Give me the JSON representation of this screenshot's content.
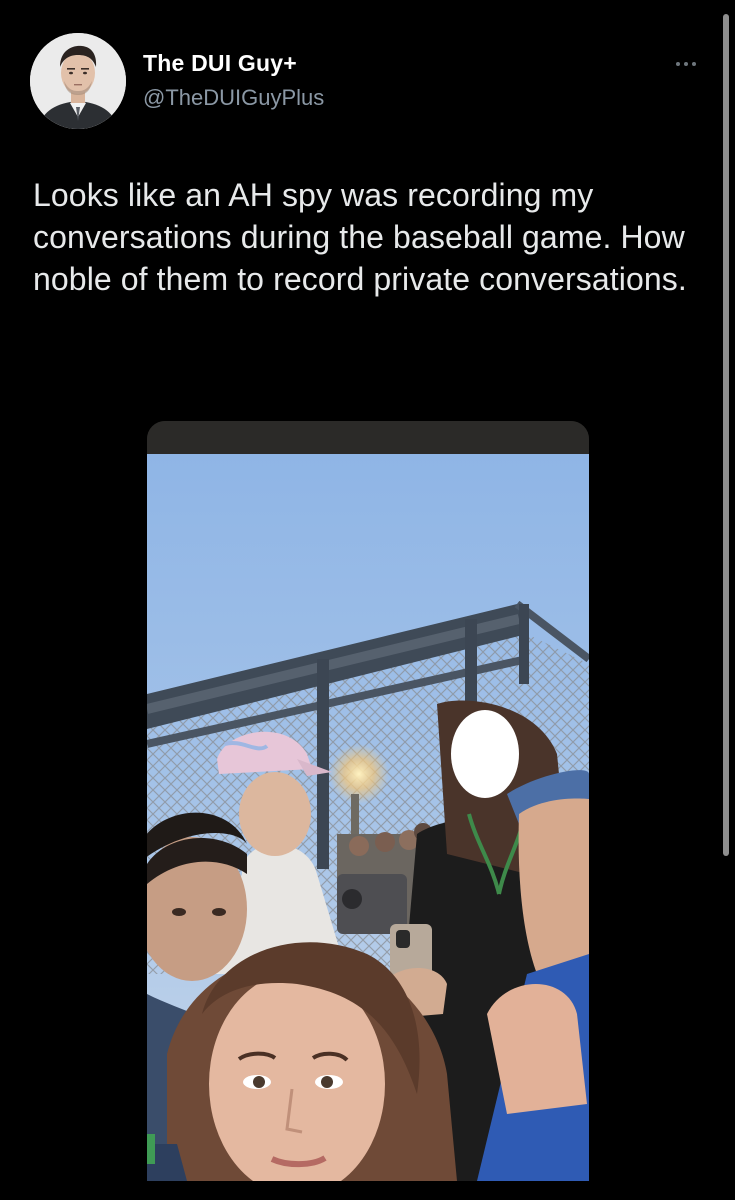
{
  "tweet": {
    "author": {
      "display_name": "The DUI Guy+",
      "handle": "@TheDUIGuyPlus",
      "avatar_icon": "profile-photo"
    },
    "more_icon": "more-dots-icon",
    "text": "Looks like an AH spy was recording my conversations during the baseball game. How noble of them to record private conversations.",
    "media": {
      "type": "photo",
      "scene": "stadium-crowd-photo"
    }
  },
  "colors": {
    "background": "#000000",
    "primary_text": "#e7e9ea",
    "secondary_text": "#8b98a5"
  }
}
